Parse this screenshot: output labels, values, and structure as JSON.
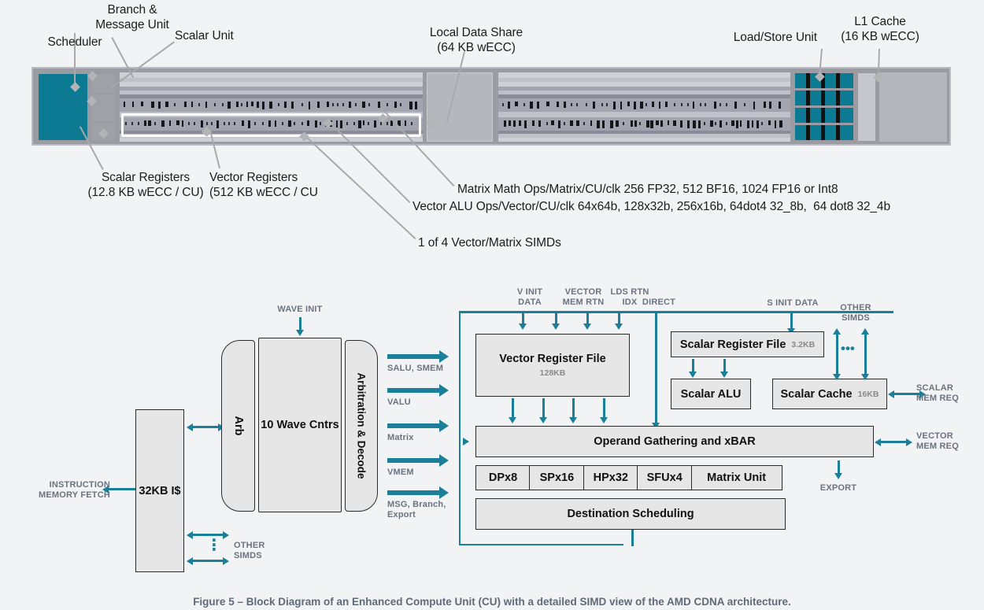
{
  "figure": {
    "caption": "Figure 5 – Block Diagram of an Enhanced Compute Unit (CU) with a detailed SIMD view of the AMD CDNA architecture."
  },
  "colors": {
    "background": "#f1f3f4",
    "teal_accent": "#1b7f99",
    "die_teal": "#0d7a93",
    "box_fill": "#e6e6e6",
    "box_border": "#2a2a2a",
    "label_text": "#1c1c1c",
    "caption_text": "#5f6b7a",
    "small_caps_text": "#6b7280",
    "leader_line": "#a9a9ac"
  },
  "die_shot": {
    "callouts_top": [
      {
        "id": "scheduler",
        "label": "Scheduler"
      },
      {
        "id": "branch-message-unit",
        "label": "Branch &\nMessage Unit"
      },
      {
        "id": "scalar-unit",
        "label": "Scalar Unit"
      },
      {
        "id": "local-data-share",
        "label": "Local Data Share\n(64 KB wECC)"
      },
      {
        "id": "load-store-unit",
        "label": "Load/Store Unit"
      },
      {
        "id": "l1-cache",
        "label": "L1 Cache\n(16 KB wECC)"
      }
    ],
    "callouts_bottom": [
      {
        "id": "scalar-registers",
        "label": "Scalar Registers\n(12.8 KB wECC / CU)"
      },
      {
        "id": "vector-registers",
        "label": "Vector Registers\n(512 KB wECC / CU"
      },
      {
        "id": "matrix-math-ops",
        "label": "Matrix Math Ops/Matrix/CU/clk 256 FP32, 512 BF16, 1024 FP16 or Int8"
      },
      {
        "id": "vector-alu-ops",
        "label": "Vector ALU Ops/Vector/CU/clk 64x64b, 128x32b, 256x16b, 64dot4 32_8b,  64 dot8 32_4b"
      },
      {
        "id": "one-of-four-simds",
        "label": "1 of 4 Vector/Matrix SIMDs"
      }
    ]
  },
  "block_diagram": {
    "instruction_memory_fetch": "INSTRUCTION\nMEMORY FETCH",
    "instruction_cache": "32KB I$",
    "arb": "Arb",
    "wave_counters": "10 Wave Cntrs",
    "arbitration_decode": "Arbitration & Decode",
    "wave_init": "WAVE INIT",
    "other_simds_left": "OTHER\nSIMDS",
    "other_simds_right": "OTHER\nSIMDS",
    "dispatch_arrows": [
      {
        "id": "salu-smem",
        "label": "SALU, SMEM"
      },
      {
        "id": "valu",
        "label": "VALU"
      },
      {
        "id": "matrix",
        "label": "Matrix"
      },
      {
        "id": "vmem",
        "label": "VMEM"
      },
      {
        "id": "msg-branch-export",
        "label": "MSG, Branch,\nExport"
      }
    ],
    "top_inputs": [
      {
        "id": "v-init-data",
        "label": "V INIT\nDATA"
      },
      {
        "id": "vector-mem-rtn",
        "label": "VECTOR\nMEM RTN"
      },
      {
        "id": "lds-rtn-idx",
        "label": "LDS RTN\nIDX"
      },
      {
        "id": "direct",
        "label": "DIRECT"
      },
      {
        "id": "s-init-data",
        "label": "S INIT DATA"
      }
    ],
    "vector_register_file": {
      "title": "Vector Register File",
      "size": "128KB"
    },
    "scalar_register_file": {
      "title": "Scalar Register File",
      "size": "3.2KB"
    },
    "scalar_alu": {
      "title": "Scalar ALU",
      "size": ""
    },
    "scalar_cache": {
      "title": "Scalar Cache",
      "size": "16KB"
    },
    "operand_gathering": "Operand Gathering and xBAR",
    "destination_scheduling": "Destination Scheduling",
    "functional_units": [
      {
        "id": "dpx8",
        "label": "DPx8"
      },
      {
        "id": "spx16",
        "label": "SPx16"
      },
      {
        "id": "hpx32",
        "label": "HPx32"
      },
      {
        "id": "sfux4",
        "label": "SFUx4"
      },
      {
        "id": "matrix-unit",
        "label": "Matrix Unit"
      }
    ],
    "right_ports": [
      {
        "id": "scalar-mem-req",
        "label": "SCALAR\nMEM REQ"
      },
      {
        "id": "vector-mem-req",
        "label": "VECTOR\nMEM REQ"
      },
      {
        "id": "export",
        "label": "EXPORT"
      }
    ]
  }
}
